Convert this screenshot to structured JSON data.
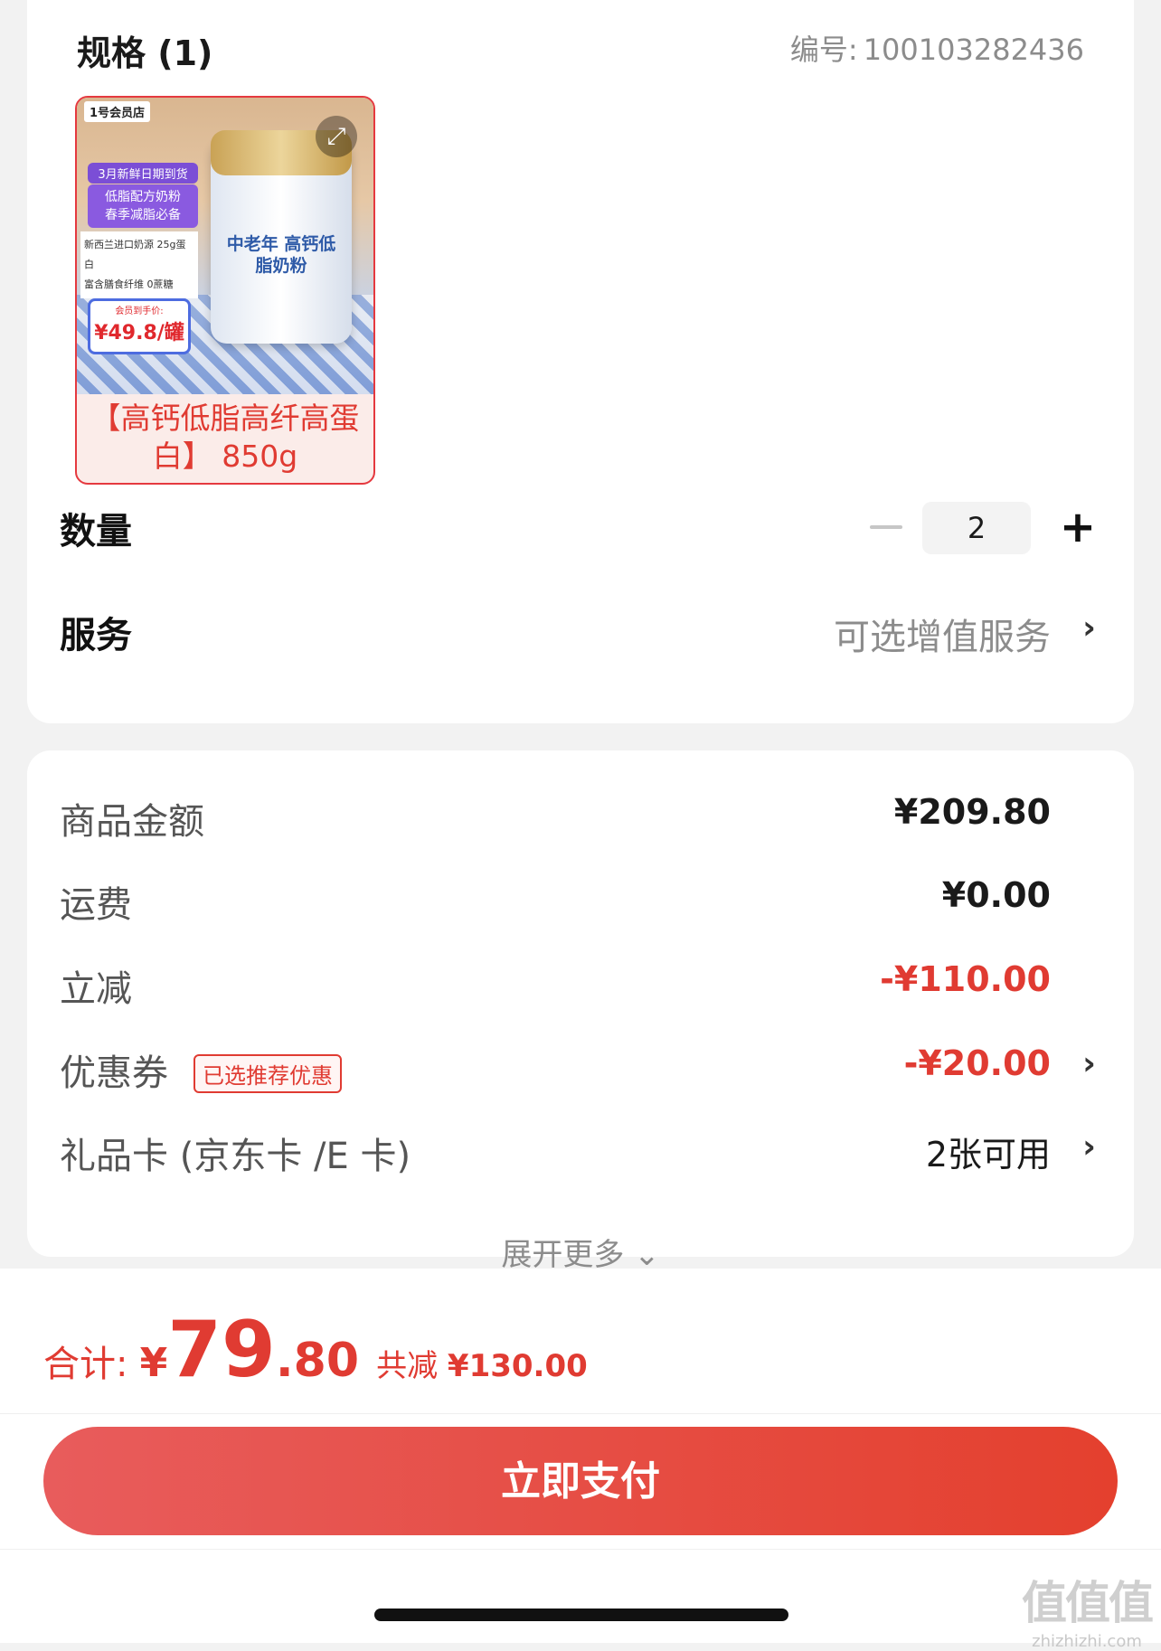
{
  "spec": {
    "title": "规格 (1)",
    "sku_label": "编号:",
    "sku_value": "100103282436",
    "product": {
      "store_logo": "1号会员店",
      "promo_date": "3月新鲜日期到货",
      "promo_lines": [
        "低脂配方奶粉",
        "春季减脂必备"
      ],
      "promo_detail_lines": [
        "新西兰进口奶源 25g蛋白",
        "富含膳食纤维 0蔗糖"
      ],
      "price_label": "会员到手价:",
      "price_value": "¥49.8/罐",
      "can_text": "中老年 高钙低脂奶粉",
      "caption": "【高钙低脂高纤高蛋白】 850g"
    }
  },
  "quantity": {
    "label": "数量",
    "value": "2",
    "minus_icon": "minus-icon",
    "plus_icon": "plus-icon"
  },
  "service": {
    "label": "服务",
    "value": "可选增值服务"
  },
  "fees": {
    "goods_amount": {
      "label": "商品金额",
      "value": "¥209.80"
    },
    "shipping": {
      "label": "运费",
      "value": "¥0.00"
    },
    "instant_discount": {
      "label": "立减",
      "value": "-¥110.00"
    },
    "coupon": {
      "label": "优惠券",
      "tag": "已选推荐优惠",
      "value": "-¥20.00"
    },
    "gift_card": {
      "label": "礼品卡 (京东卡 /E 卡)",
      "value": "2张可用"
    },
    "expand_more": "展开更多"
  },
  "total": {
    "label": "合计:",
    "currency": "¥",
    "amount_int": "79",
    "amount_dec": ".80",
    "saved_label": "共减",
    "saved_value": "¥130.00"
  },
  "pay_button": "立即支付",
  "watermark": {
    "text": "值值值",
    "domain": "zhizhizhi.com"
  },
  "colors": {
    "accent_red": "#e03b32",
    "button_gradient_start": "#e85c5c",
    "button_gradient_end": "#e4402e",
    "page_bg": "#f2f2f2"
  }
}
